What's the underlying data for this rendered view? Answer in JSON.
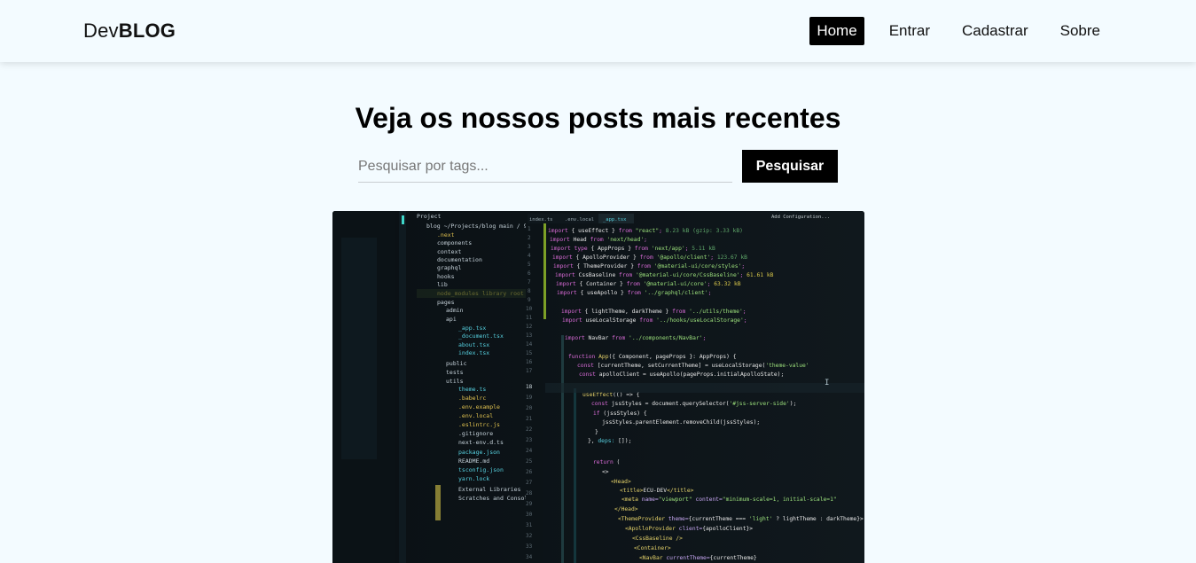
{
  "brand": {
    "prefix": "Dev",
    "bold": "BLOG"
  },
  "nav": {
    "items": [
      {
        "label": "Home",
        "active": true
      },
      {
        "label": "Entrar",
        "active": false
      },
      {
        "label": "Cadastrar",
        "active": false
      },
      {
        "label": "Sobre",
        "active": false
      }
    ]
  },
  "main": {
    "title": "Veja os nossos posts mais recentes",
    "search": {
      "placeholder": "Pesquisar por tags...",
      "value": "",
      "button_label": "Pesquisar"
    },
    "post": {
      "image_icon": "code-editor-screenshot"
    }
  },
  "colors": {
    "background": "#f3fbff",
    "accent": "#000000",
    "code_bg": "#0e1419"
  }
}
